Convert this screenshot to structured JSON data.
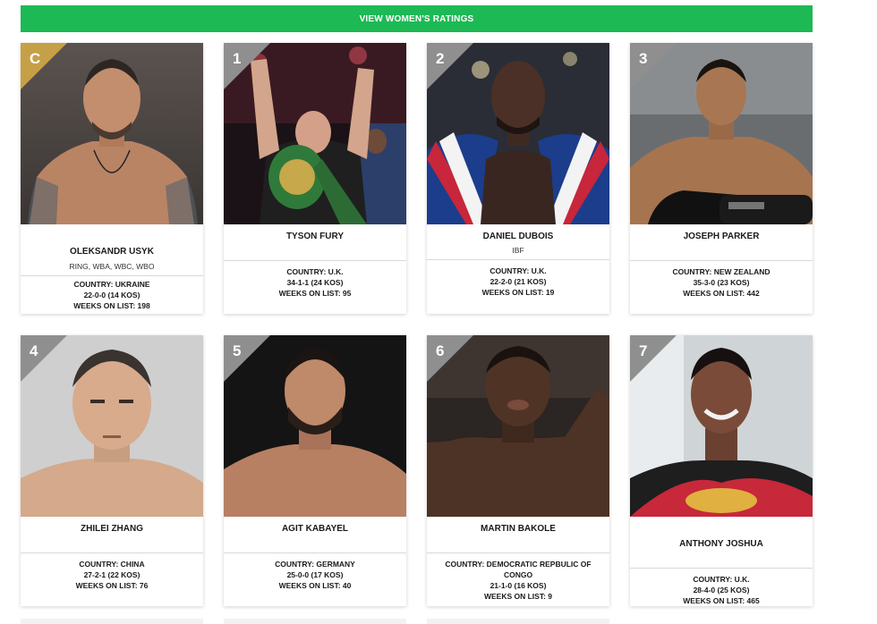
{
  "banner": {
    "label": "VIEW WOMEN'S RATINGS"
  },
  "colors": {
    "banner": "#1db954",
    "champion_badge": "#c6a046",
    "rank_badge": "#8f8f8f"
  },
  "fighters": [
    {
      "rank": "C",
      "name": "OLEKSANDR USYK",
      "titles": "RING, WBA, WBC, WBO",
      "country": "COUNTRY: UKRAINE",
      "record": "22-0-0 (14 KOS)",
      "weeks": "WEEKS ON LIST: 198"
    },
    {
      "rank": "1",
      "name": "TYSON FURY",
      "titles": "",
      "country": "COUNTRY: U.K.",
      "record": "34-1-1 (24 KOS)",
      "weeks": "WEEKS ON LIST: 95"
    },
    {
      "rank": "2",
      "name": "DANIEL DUBOIS",
      "titles": "IBF",
      "country": "COUNTRY: U.K.",
      "record": "22-2-0 (21 KOS)",
      "weeks": "WEEKS ON LIST: 19"
    },
    {
      "rank": "3",
      "name": "JOSEPH PARKER",
      "titles": "",
      "country": "COUNTRY: NEW ZEALAND",
      "record": "35-3-0 (23 KOS)",
      "weeks": "WEEKS ON LIST: 442"
    },
    {
      "rank": "4",
      "name": "ZHILEI ZHANG",
      "titles": "",
      "country": "COUNTRY: CHINA",
      "record": "27-2-1 (22 KOS)",
      "weeks": "WEEKS ON LIST: 76"
    },
    {
      "rank": "5",
      "name": "AGIT KABAYEL",
      "titles": "",
      "country": "COUNTRY: GERMANY",
      "record": "25-0-0 (17 KOS)",
      "weeks": "WEEKS ON LIST: 40"
    },
    {
      "rank": "6",
      "name": "MARTIN BAKOLE",
      "titles": "",
      "country": "COUNTRY: DEMOCRATIC REPBULIC OF CONGO",
      "record": "21-1-0 (16 KOS)",
      "weeks": "WEEKS ON LIST: 9"
    },
    {
      "rank": "7",
      "name": "ANTHONY JOSHUA",
      "titles": "",
      "country": "COUNTRY: U.K.",
      "record": "28-4-0 (25 KOS)",
      "weeks": "WEEKS ON LIST: 465"
    }
  ]
}
